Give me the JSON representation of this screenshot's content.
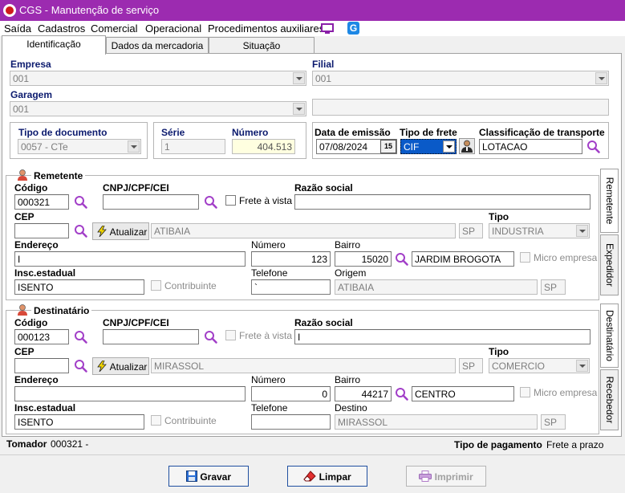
{
  "window": {
    "title": "CGS - Manutenção de serviço"
  },
  "menu": {
    "items": [
      "Saída",
      "Cadastros",
      "Comercial",
      "Operacional",
      "Procedimentos auxiliares"
    ],
    "icons": [
      "monitor-icon",
      "app-icon"
    ]
  },
  "tabs": [
    "Identificação",
    "Dados da mercadoria",
    "Situação"
  ],
  "empresa": {
    "label": "Empresa",
    "value": "001"
  },
  "filial": {
    "label": "Filial",
    "value": "001"
  },
  "garagem": {
    "label": "Garagem",
    "value": "001"
  },
  "tipo_documento": {
    "label": "Tipo de documento",
    "value": "0057 - CTe"
  },
  "serie": {
    "label": "Série",
    "value": "1"
  },
  "numero": {
    "label": "Número",
    "value": "404.513"
  },
  "data_emissao": {
    "label": "Data de emissão",
    "value": "07/08/2024",
    "cal": "15"
  },
  "tipo_frete": {
    "label": "Tipo de frete",
    "value": "CIF"
  },
  "classificacao": {
    "label": "Classificação de transporte",
    "value": "LOTACAO"
  },
  "remetente": {
    "title": "Remetente",
    "codigo_label": "Código",
    "codigo": "000321",
    "cnpj_label": "CNPJ/CPF/CEI",
    "cnpj": "",
    "frete_vista_label": "Frete à vista",
    "razao_label": "Razão social",
    "razao": "",
    "cep_label": "CEP",
    "cep": "",
    "atualizar": "Atualizar",
    "cidade": "ATIBAIA",
    "uf": "SP",
    "tipo_label": "Tipo",
    "tipo": "INDUSTRIA",
    "endereco_label": "Endereço",
    "endereco": "I",
    "numero_label": "Número",
    "numero": "123",
    "bairro_label": "Bairro",
    "bairro_cod": "15020",
    "bairro": "JARDIM BROGOTA",
    "micro_label": "Micro empresa",
    "ie_label": "Insc.estadual",
    "ie": "ISENTO",
    "contribuinte_label": "Contribuinte",
    "telefone_label": "Telefone",
    "telefone": "`",
    "origem_label": "Origem",
    "origem": "ATIBAIA",
    "origem_uf": "SP"
  },
  "destinatario": {
    "title": "Destinatário",
    "codigo_label": "Código",
    "codigo": "000123",
    "cnpj_label": "CNPJ/CPF/CEI",
    "cnpj": "",
    "frete_vista_label": "Frete à vista",
    "razao_label": "Razão social",
    "razao": "I",
    "cep_label": "CEP",
    "cep": "",
    "atualizar": "Atualizar",
    "cidade": "MIRASSOL",
    "uf": "SP",
    "tipo_label": "Tipo",
    "tipo": "COMERCIO",
    "endereco_label": "Endereço",
    "endereco": "",
    "numero_label": "Número",
    "numero": "0",
    "bairro_label": "Bairro",
    "bairro_cod": "44217",
    "bairro": "CENTRO",
    "micro_label": "Micro empresa",
    "ie_label": "Insc.estadual",
    "ie": "ISENTO",
    "contribuinte_label": "Contribuinte",
    "telefone_label": "Telefone",
    "telefone": "",
    "destino_label": "Destino",
    "destino": "MIRASSOL",
    "destino_uf": "SP"
  },
  "side_tabs": [
    "Remetente",
    "Expedidor",
    "Destinatário",
    "Recebedor"
  ],
  "tomador": {
    "label": "Tomador",
    "value": "000321 -"
  },
  "tipo_pagamento": {
    "label": "Tipo de pagamento",
    "value": "Frete a prazo"
  },
  "buttons": {
    "gravar": "Gravar",
    "limpar": "Limpar",
    "imprimir": "Imprimir"
  },
  "colors": {
    "titlebar": "#9c2bb0",
    "label_navy": "#0b1a6e",
    "search": "#a23fc8"
  }
}
